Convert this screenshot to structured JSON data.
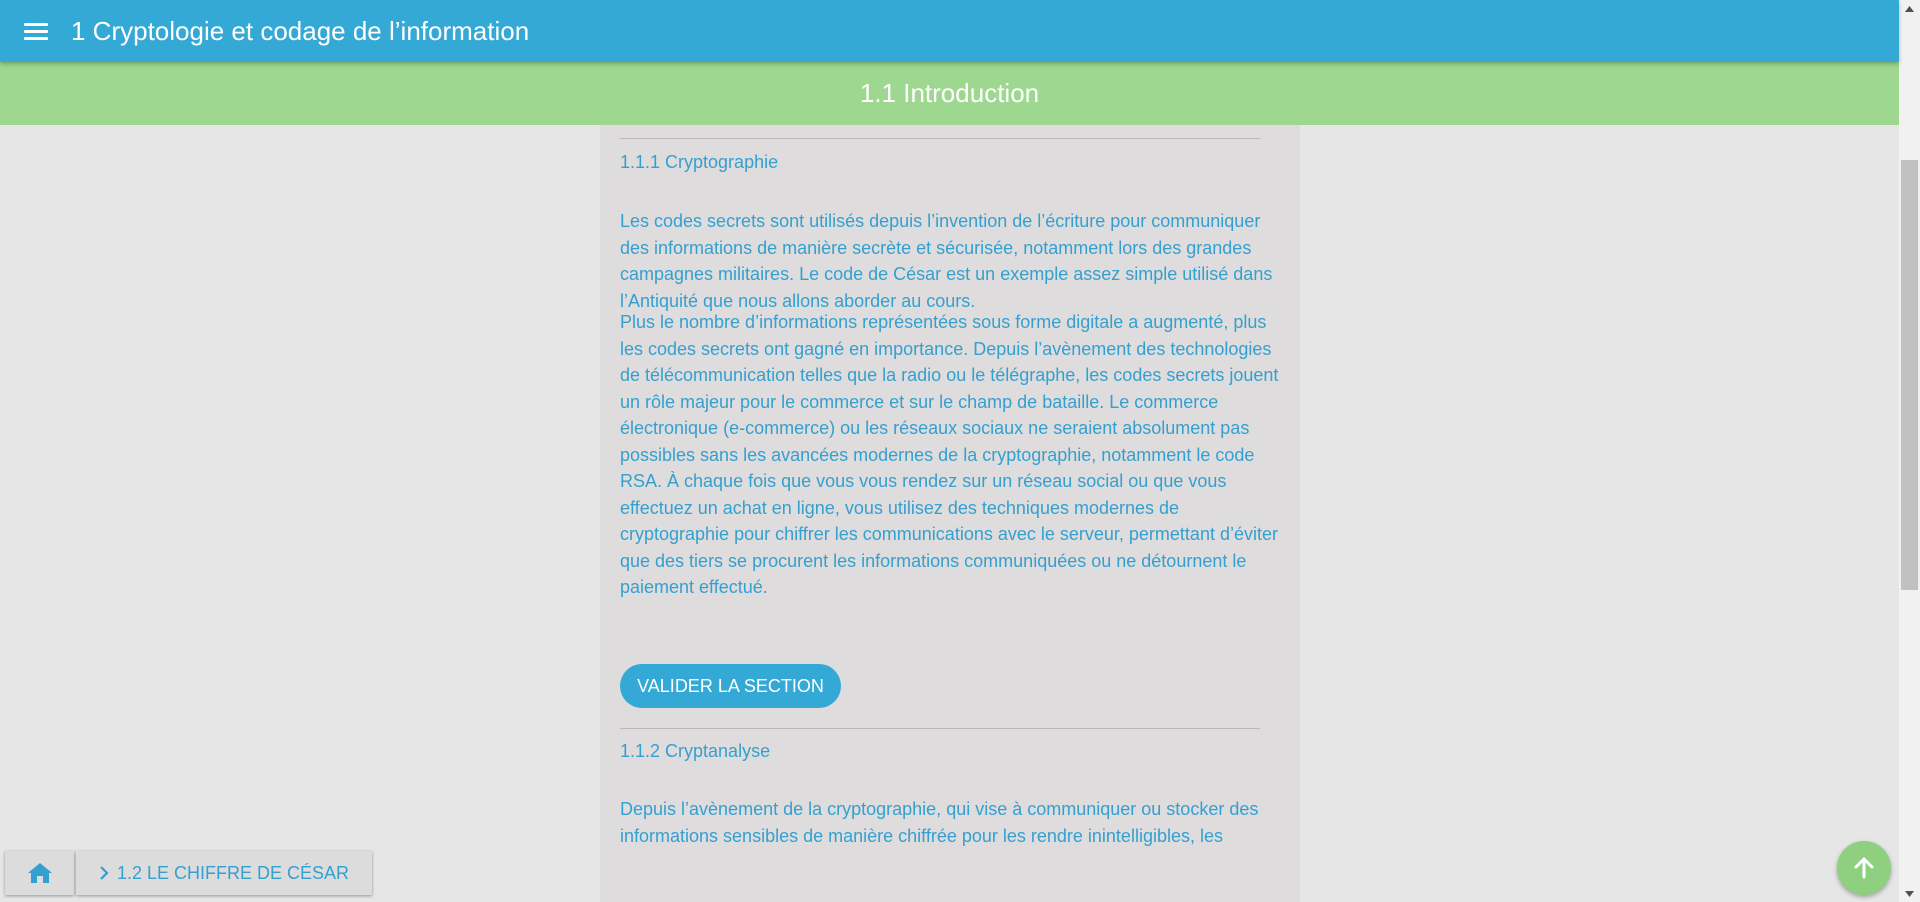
{
  "header": {
    "title": "1 Cryptologie et codage de l’information"
  },
  "subheader": {
    "title": "1.1 Introduction"
  },
  "content": {
    "section1": {
      "title": "1.1.1 Cryptographie",
      "paragraphs": [
        "Les codes secrets sont utilisés depuis l’invention de l’écriture pour communiquer des informations de manière secrète et sécurisée, notamment lors des grandes campagnes militaires. Le code de César est un exemple assez simple utilisé dans l’Antiquité que nous allons aborder au cours.",
        "Plus le nombre d’informations représentées sous forme digitale a augmenté, plus les codes secrets ont gagné en importance. Depuis l’avènement des technologies de télécommunication telles que la radio ou le télégraphe, les codes secrets jouent un rôle majeur pour le commerce et sur le champ de bataille. Le commerce électronique (e-commerce) ou les réseaux sociaux ne seraient absolument pas possibles sans les avancées modernes de la cryptographie, notamment le code RSA. À chaque fois que vous vous rendez sur un réseau social ou que vous effectuez un achat en ligne, vous utilisez des techniques modernes de cryptographie pour chiffrer les communications avec le serveur, permettant d’éviter que des tiers se procurent les informations communiquées ou ne détournent le paiement effectué."
      ],
      "button": "VALIDER LA SECTION"
    },
    "section2": {
      "title": "1.1.2 Cryptanalyse",
      "paragraph": "Depuis l’avènement de la cryptographie, qui vise à communiquer ou stocker des informations sensibles de manière chiffrée pour les rendre inintelligibles, les"
    }
  },
  "bottom_nav": {
    "home_icon": "home-icon",
    "next_label": "1.2 LE CHIFFRE DE CÉSAR"
  },
  "fab": {
    "icon": "arrow-up-icon"
  },
  "colors": {
    "primary": "#34a9d6",
    "subheader": "#9ed78f",
    "text": "#34a0d0",
    "fab": "#8fcf80"
  }
}
